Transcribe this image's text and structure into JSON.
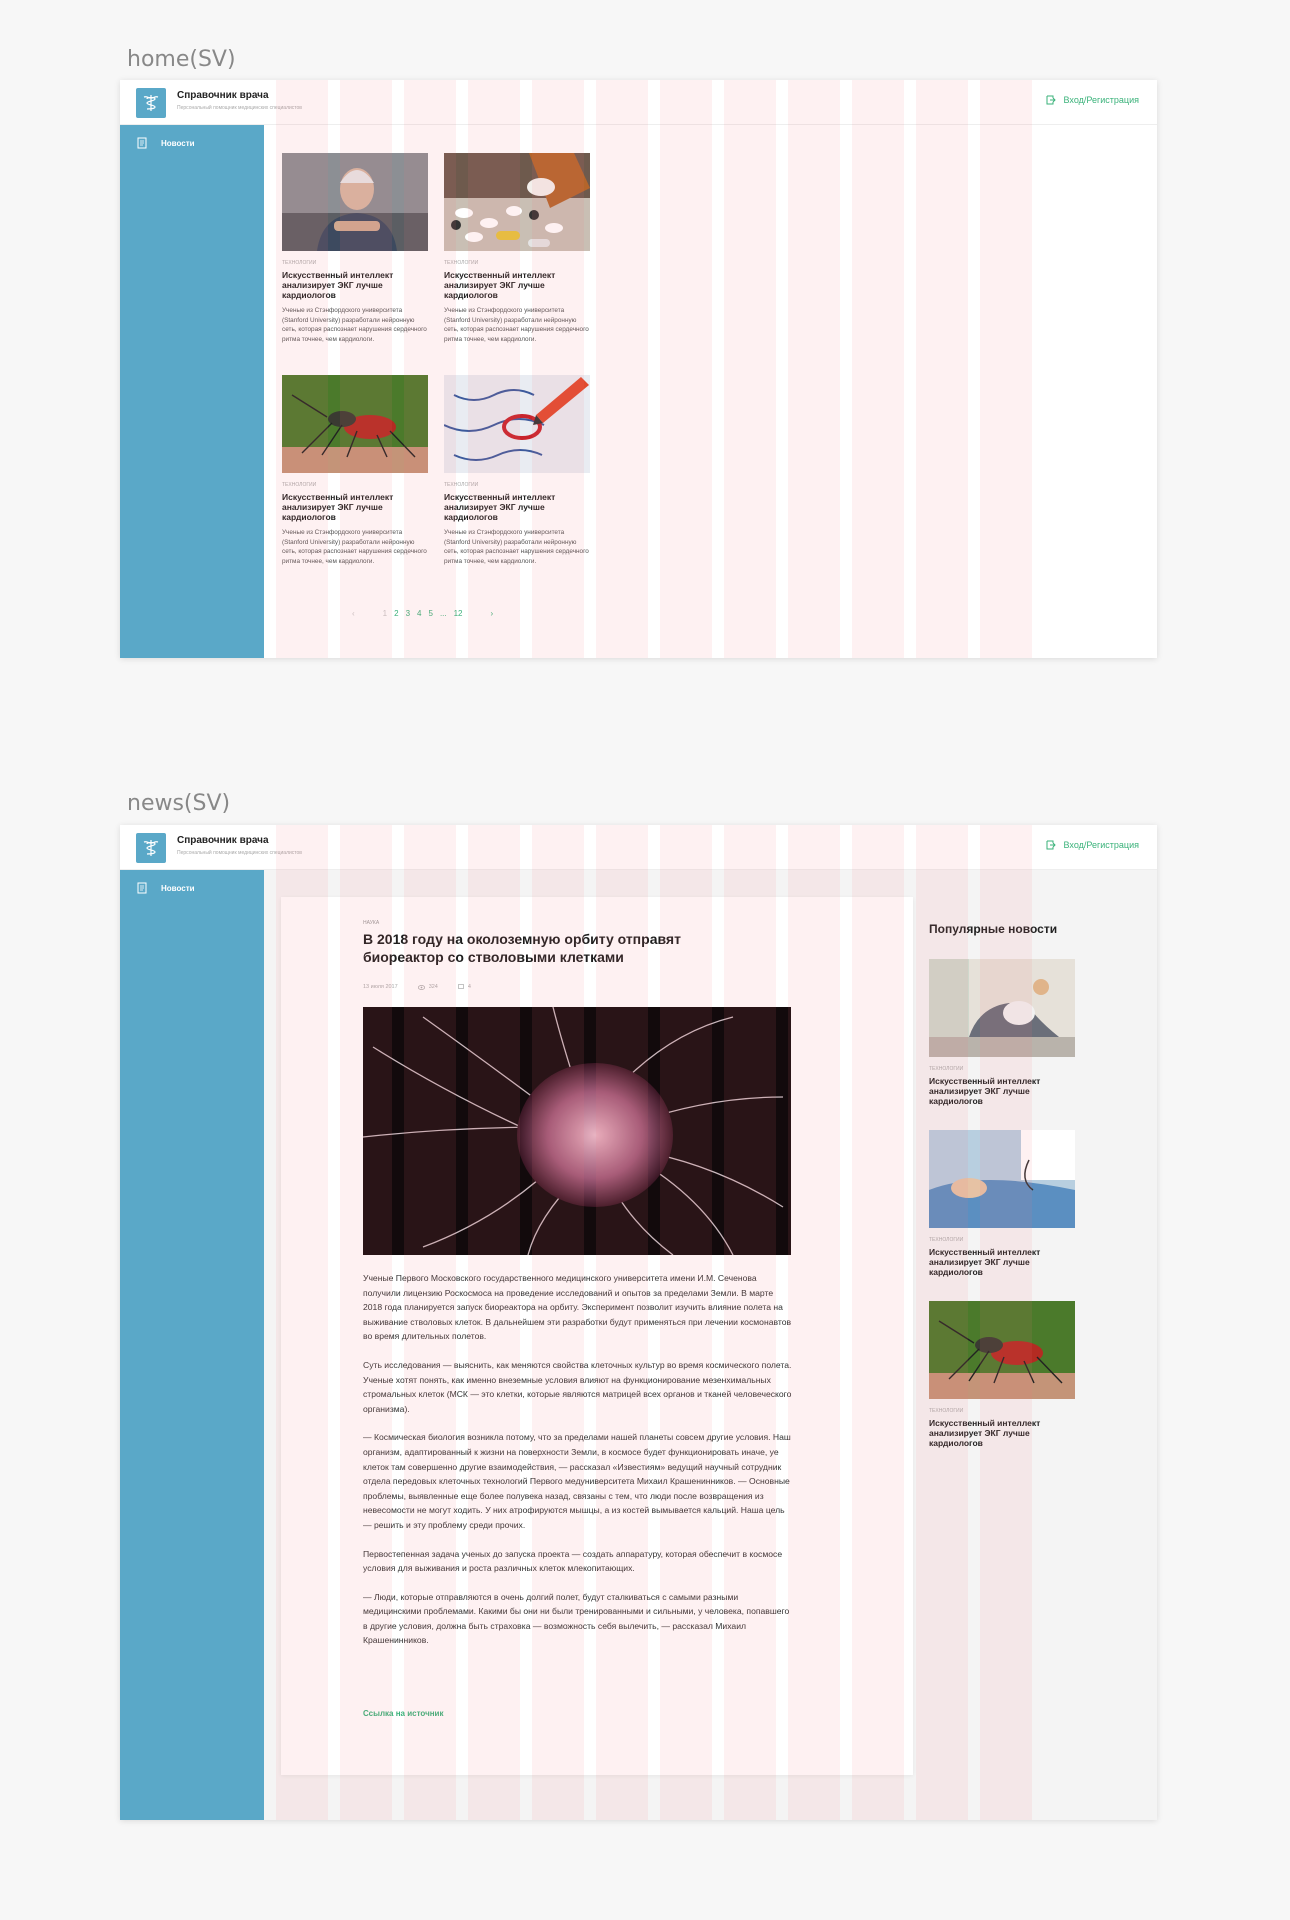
{
  "frames": {
    "home_label": "home(SV)",
    "news_label": "news(SV)"
  },
  "header": {
    "brand_name": "Справочник врача",
    "brand_sub": "Персональный помощник медицинских специалистов",
    "login_label": "Вход/Регистрация"
  },
  "sidebar": {
    "items": [
      {
        "label": "Новости",
        "icon": "document-icon"
      }
    ]
  },
  "home": {
    "cards": [
      {
        "category": "технологии",
        "title": "Искусственный интеллект анализирует ЭКГ лучше кардиологов",
        "excerpt": "Ученые из Стэнфордского университета (Stanford University) разработали нейронную сеть, которая распознает нарушения сердечного ритма точнее, чем кардиологи.",
        "image": "elderly-man"
      },
      {
        "category": "технологии",
        "title": "Искусственный интеллект анализирует ЭКГ лучше кардиологов",
        "excerpt": "Ученые из Стэнфордского университета (Stanford University) разработали нейронную сеть, которая распознает нарушения сердечного ритма точнее, чем кардиологи.",
        "image": "pills"
      },
      {
        "category": "технологии",
        "title": "Искусственный интеллект анализирует ЭКГ лучше кардиологов",
        "excerpt": "Ученые из Стэнфордского университета (Stanford University) разработали нейронную сеть, которая распознает нарушения сердечного ритма точнее, чем кардиологи.",
        "image": "mosquito"
      },
      {
        "category": "технологии",
        "title": "Искусственный интеллект анализирует ЭКГ лучше кардиологов",
        "excerpt": "Ученые из Стэнфордского университета (Stanford University) разработали нейронную сеть, которая распознает нарушения сердечного ритма точнее, чем кардиологи.",
        "image": "cells-pencil"
      }
    ],
    "pager": {
      "prev": "‹",
      "pages": [
        "1",
        "2",
        "3",
        "4",
        "5",
        "...",
        "12"
      ],
      "next": "›",
      "current": "1"
    }
  },
  "news": {
    "category": "наука",
    "title": "В 2018 году на околоземную орбиту отправят биореактор со стволовыми клетками",
    "date": "13 июля 2017",
    "views": "324",
    "comments": "4",
    "paragraphs": [
      "Ученые Первого Московского государственного медицинского университета имени И.М. Сеченова получили лицензию Роскосмоса на проведение исследований и опытов за пределами Земли. В марте 2018 года планируется запуск биореактора на орбиту. Эксперимент позволит изучить влияние полета на выживание стволовых клеток. В дальнейшем эти разработки будут применяться при лечении космонавтов во время длительных полетов.",
      "Суть исследования — выяснить, как меняются свойства клеточных культур во время космического полета. Ученые хотят понять, как именно внеземные условия влияют на функционирование мезенхимальных стромальных клеток (МСК — это клетки, которые являются матрицей всех органов и тканей человеческого организма).",
      "— Космическая биология возникла потому, что за пределами нашей планеты совсем другие условия. Наш организм, адаптированный к жизни на поверхности Земли, в космосе будет функционировать иначе, уе клеток там совершенно другие взаимодействия, — рассказал «Известиям» ведущий научный сотрудник отдела передовых клеточных технологий Первого медуниверситета Михаил Крашенинников. — Основные проблемы, выявленные еще более полувека назад, связаны с тем, что люди после возвращения из невесомости не могут ходить. У них атрофируются мышцы, а из костей вымывается кальций. Наша цель — решить и эту проблему среди прочих.",
      "Первостепенная задача ученых до запуска проекта — создать аппаратуру, которая обеспечит в космосе условия для выживания и роста различных клеток млекопитающих.",
      "— Люди, которые отправляются в очень долгий полет, будут сталкиваться с самыми разными медицинскими проблемами. Какими бы они ни были тренированными и сильными, у человека, попавшего в другие условия, должна быть страховка — возможность себя вылечить, — рассказал Михаил Крашенинников."
    ],
    "source_link": "Ссылка на источник",
    "popular_title": "Популярные новости",
    "popular": [
      {
        "category": "технологии",
        "title": "Искусственный интеллект анализирует ЭКГ лучше кардиологов",
        "image": "pregnant-yoga"
      },
      {
        "category": "технологии",
        "title": "Искусственный интеллект анализирует ЭКГ лучше кардиологов",
        "image": "patient-exam"
      },
      {
        "category": "технологии",
        "title": "Искусственный интеллект анализирует ЭКГ лучше кардиологов",
        "image": "mosquito"
      }
    ]
  },
  "colors": {
    "sidebar": "#5aa8c8",
    "accent": "#3ab27a",
    "grid_overlay": "#fde8ea"
  }
}
